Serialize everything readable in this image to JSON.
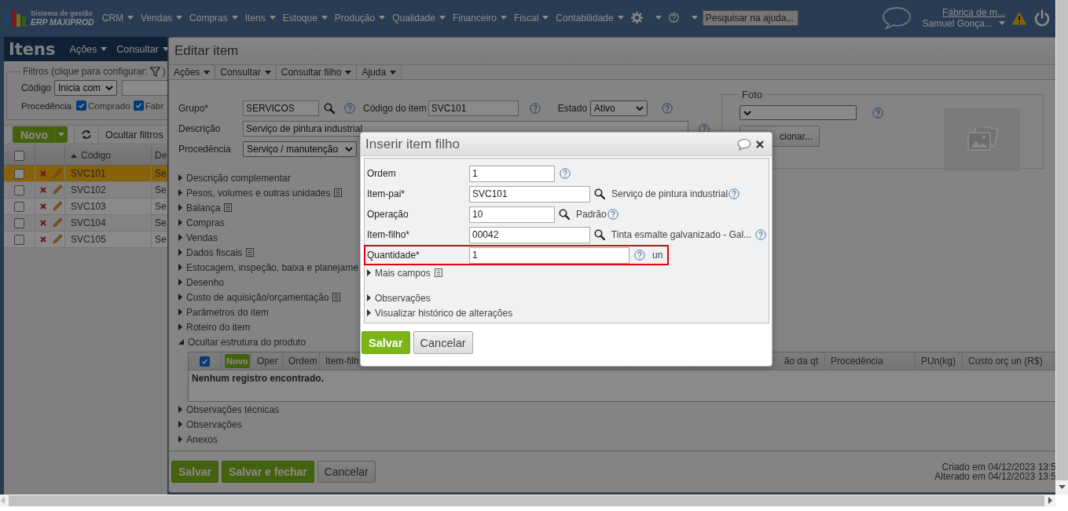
{
  "top_nav": {
    "brand_line1": "Sistema de gestão",
    "brand_line2": "ERP MAXIPROD",
    "menus": [
      "CRM",
      "Vendas",
      "Compras",
      "Itens",
      "Estoque",
      "Produção",
      "Qualidade",
      "Financeiro",
      "Fiscal",
      "Contabilidade"
    ],
    "search": {
      "placeholder": "Pesquisar na ajuda..."
    },
    "company": "Fábrica de m...",
    "user": "Samuel Gonça..."
  },
  "items_panel": {
    "title": "Itens",
    "menus": [
      "Ações",
      "Consultar"
    ],
    "filters": {
      "legend": "Filtros (clique para configurar:",
      "legend_end": ")",
      "code_label": "Código",
      "code_operator": "Inicia com",
      "origin_label": "Procedência",
      "origins": [
        {
          "label": "Comprado",
          "checked": true
        },
        {
          "label": "Fabr",
          "checked": true
        }
      ]
    },
    "new_button": "Novo",
    "hide_filters": "Ocultar filtros",
    "header_checked": false,
    "columns": [
      "Código",
      "De"
    ],
    "rows": [
      {
        "code": "SVC101",
        "description": "Se",
        "selected": true,
        "checked": false
      },
      {
        "code": "SVC102",
        "description": "Se",
        "selected": false,
        "checked": false
      },
      {
        "code": "SVC103",
        "description": "Se",
        "selected": false,
        "checked": false
      },
      {
        "code": "SVC104",
        "description": "Se",
        "selected": false,
        "checked": false
      },
      {
        "code": "SVC105",
        "description": "Se",
        "selected": false,
        "checked": false
      }
    ]
  },
  "edit_window": {
    "title": "Editar item",
    "menus": [
      "Ações",
      "Consultar",
      "Consultar filho",
      "Ajuda"
    ],
    "group": {
      "label": "Grupo*",
      "value": "SERVICOS"
    },
    "code": {
      "label": "Código do item",
      "value": "SVC101"
    },
    "status": {
      "label": "Estado",
      "value": "Ativo"
    },
    "description": {
      "label": "Descrição",
      "value": "Serviço de pintura industrial"
    },
    "origin": {
      "label": "Procedência",
      "value": "Serviço / manutenção"
    },
    "photo": {
      "legend": "Foto",
      "select_button": "cionar..."
    },
    "sections": [
      {
        "label": "Descrição complementar",
        "expanded": false,
        "note_icon": false
      },
      {
        "label": "Pesos, volumes e outras unidades",
        "expanded": false,
        "note_icon": true
      },
      {
        "label": "Balança",
        "expanded": false,
        "note_icon": true
      },
      {
        "label": "Compras",
        "expanded": false,
        "note_icon": false
      },
      {
        "label": "Vendas",
        "expanded": false,
        "note_icon": false
      },
      {
        "label": "Dados fiscais",
        "expanded": false,
        "note_icon": true
      },
      {
        "label": "Estocagem, inspeção, baixa e planejame",
        "expanded": false,
        "note_icon": false
      },
      {
        "label": "Desenho",
        "expanded": false,
        "note_icon": false
      },
      {
        "label": "Custo de aquisição/orçamentação",
        "expanded": false,
        "note_icon": true
      },
      {
        "label": "Parâmetros do item",
        "expanded": false,
        "note_icon": false
      },
      {
        "label": "Roteiro do item",
        "expanded": false,
        "note_icon": false
      },
      {
        "label": "Ocultar estrutura do produto",
        "expanded": true,
        "note_icon": false
      }
    ],
    "structure_table": {
      "all_checked": true,
      "new_button": "Novo",
      "columns": [
        "Oper",
        "Ordem",
        "Item-filh",
        "ão da qt",
        "Procedência",
        "PUn(kg)",
        "Custo orç un (R$)"
      ],
      "empty_message": "Nenhum registro encontrado."
    },
    "sections_after": [
      {
        "label": "Observações técnicas",
        "expanded": false,
        "note_icon": false
      },
      {
        "label": "Observações",
        "expanded": false,
        "note_icon": false
      },
      {
        "label": "Anexos",
        "expanded": false,
        "note_icon": false
      }
    ],
    "buttons": [
      {
        "label": "Salvar",
        "kind": "primary"
      },
      {
        "label": "Salvar e fechar",
        "kind": "primary"
      },
      {
        "label": "Cancelar",
        "kind": "secondary"
      }
    ],
    "created": "Criado em 04/12/2023 13:5",
    "modified": "Alterado em 04/12/2023 13:5"
  },
  "dialog": {
    "title": "Inserir item filho",
    "fields": [
      {
        "label": "Ordem",
        "value": "1",
        "kind": "short",
        "lookup": false,
        "highlighted": false
      },
      {
        "label": "Item-pai*",
        "value": "SVC101",
        "kind": "long",
        "lookup": true,
        "description": "Serviço de pintura industrial",
        "highlighted": false
      },
      {
        "label": "Operação",
        "value": "10",
        "kind": "short",
        "lookup": true,
        "description": "Padrão",
        "highlighted": false
      },
      {
        "label": "Item-filho*",
        "value": "00042",
        "kind": "long",
        "lookup": true,
        "description": "Tinta esmalte galvanizado - Gal...",
        "highlighted": false
      },
      {
        "label": "Quantidade*",
        "value": "1",
        "kind": "wide",
        "lookup": false,
        "unit": "un",
        "highlighted": true
      }
    ],
    "more_fields": {
      "label": "Mais campos",
      "expanded": false,
      "note_icon": true
    },
    "sections": [
      {
        "label": "Observações",
        "expanded": false,
        "note_icon": false
      },
      {
        "label": "Visualizar histórico de alterações",
        "expanded": false,
        "note_icon": false
      }
    ],
    "buttons": [
      {
        "label": "Salvar",
        "kind": "primary"
      },
      {
        "label": "Cancelar",
        "kind": "secondary"
      }
    ]
  }
}
